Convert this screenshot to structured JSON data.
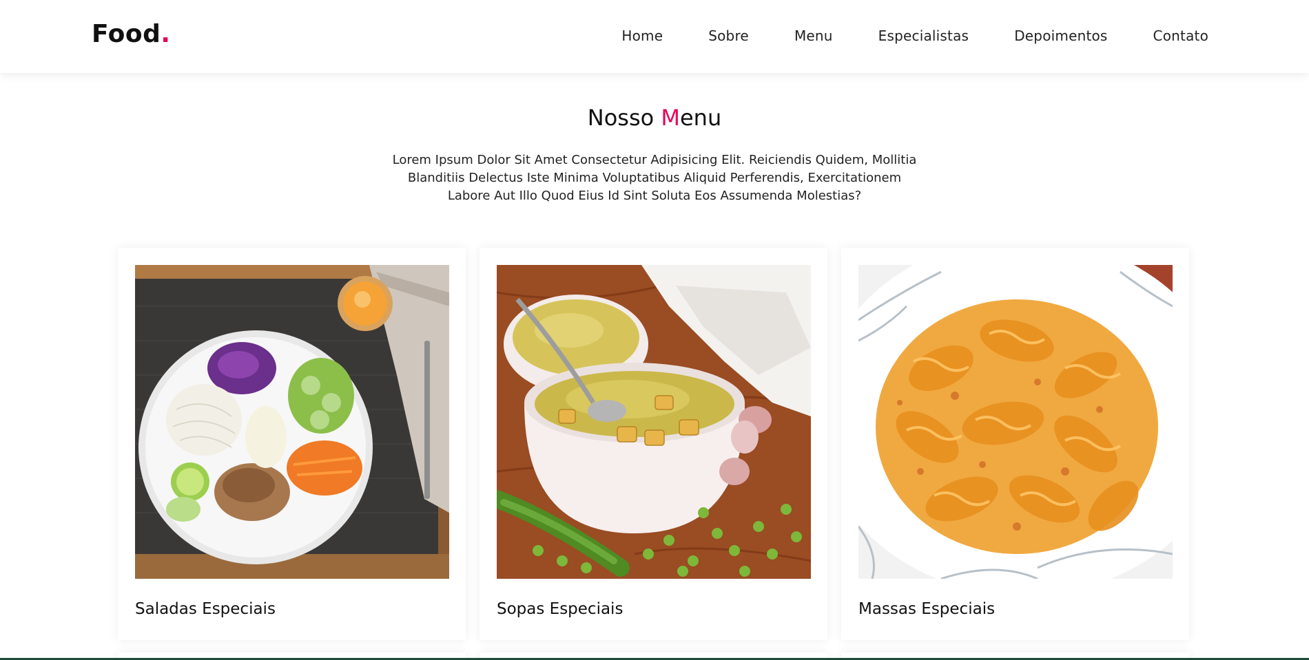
{
  "header": {
    "logo_text": "Food",
    "logo_dot": ".",
    "nav": [
      {
        "label": "Home"
      },
      {
        "label": "Sobre"
      },
      {
        "label": "Menu"
      },
      {
        "label": "Especialistas"
      },
      {
        "label": "Depoimentos"
      },
      {
        "label": "Contato"
      }
    ]
  },
  "section": {
    "title_part1": "Nosso ",
    "title_accent": "M",
    "title_part2": "enu",
    "description": "Lorem Ipsum Dolor Sit Amet Consectetur Adipisicing Elit. Reiciendis Quidem, Mollitia Blanditiis Delectus Iste Minima Voluptatibus Aliquid Perferendis, Exercitationem Labore Aut Illo Quod Eius Id Sint Soluta Eos Assumenda Molestias?"
  },
  "cards": [
    {
      "title": "Saladas Especiais"
    },
    {
      "title": "Sopas Especiais"
    },
    {
      "title": "Massas Especiais"
    }
  ],
  "colors": {
    "accent": "#e9005a",
    "text": "#111111"
  }
}
